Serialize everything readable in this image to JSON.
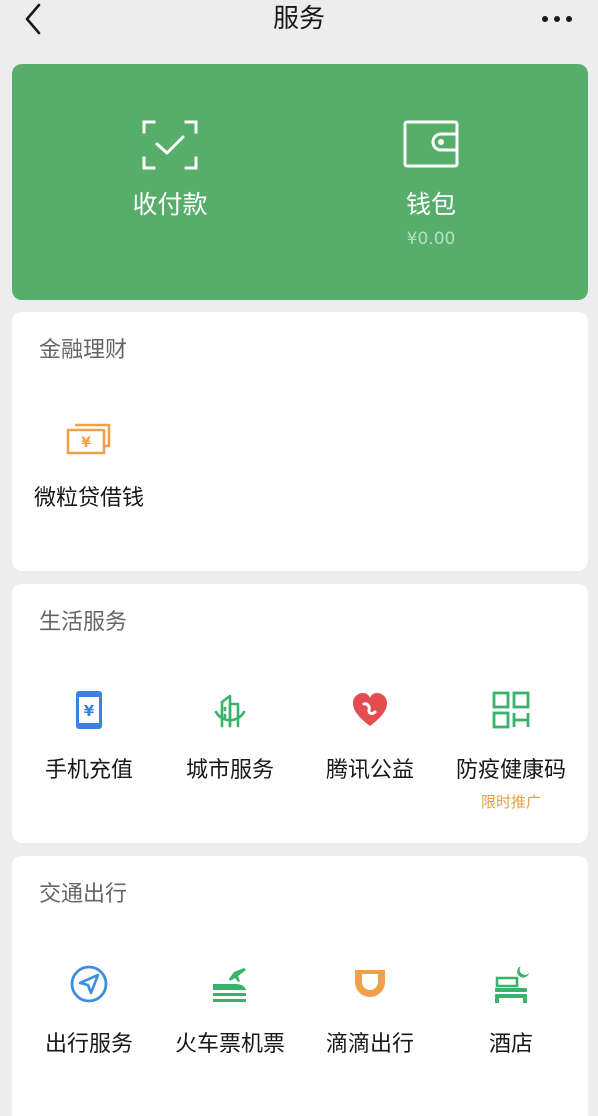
{
  "nav": {
    "title": "服务",
    "back_icon": "chevron-left-icon",
    "more_icon": "more-icon"
  },
  "top": {
    "pay": {
      "label": "收付款",
      "icon": "scan-check-icon"
    },
    "wallet": {
      "label": "钱包",
      "balance": "¥0.00",
      "icon": "wallet-icon"
    }
  },
  "sections": {
    "finance": {
      "title": "金融理财",
      "items": [
        {
          "label": "微粒贷借钱",
          "icon": "cash-icon",
          "color": "#f0a04b"
        }
      ]
    },
    "life": {
      "title": "生活服务",
      "items": [
        {
          "label": "手机充值",
          "icon": "phone-recharge-icon",
          "color": "#3b82e0"
        },
        {
          "label": "城市服务",
          "icon": "city-buildings-icon",
          "color": "#3bb26b"
        },
        {
          "label": "腾讯公益",
          "icon": "heart-icon",
          "color": "#e44c52"
        },
        {
          "label": "防疫健康码",
          "sub": "限时推广",
          "icon": "qr-code-icon",
          "color": "#3bb26b"
        }
      ]
    },
    "transport": {
      "title": "交通出行",
      "items": [
        {
          "label": "出行服务",
          "icon": "navigation-icon",
          "color": "#3b8ee0"
        },
        {
          "label": "火车票机票",
          "icon": "train-plane-icon",
          "color": "#3bb26b"
        },
        {
          "label": "滴滴出行",
          "icon": "didi-icon",
          "color": "#f0a04b"
        },
        {
          "label": "酒店",
          "icon": "hotel-bed-icon",
          "color": "#3bb26b"
        }
      ]
    }
  }
}
